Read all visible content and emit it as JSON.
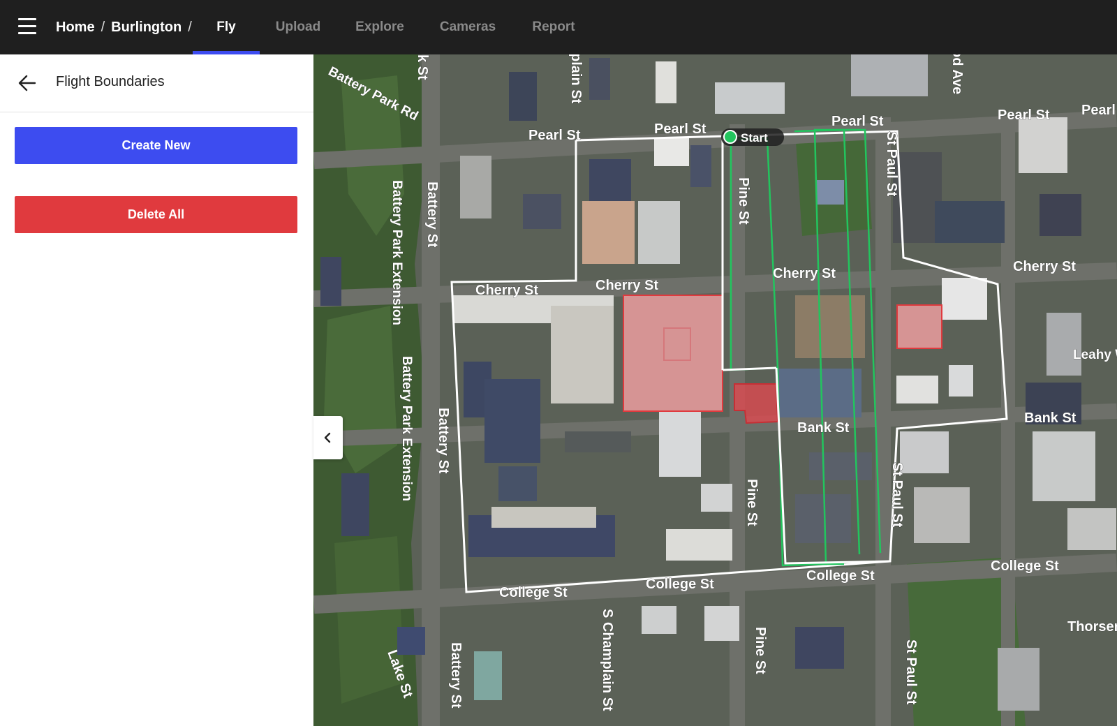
{
  "header": {
    "breadcrumb": [
      "Home",
      "Burlington"
    ],
    "separator": "/",
    "tabs": [
      {
        "label": "Fly",
        "active": true
      },
      {
        "label": "Upload",
        "active": false
      },
      {
        "label": "Explore",
        "active": false
      },
      {
        "label": "Cameras",
        "active": false
      },
      {
        "label": "Report",
        "active": false
      }
    ],
    "accent_color": "#3d4cf0"
  },
  "sidebar": {
    "title": "Flight Boundaries",
    "create_label": "Create New",
    "delete_label": "Delete All",
    "create_color": "#3d4cf0",
    "delete_color": "#e03a3e"
  },
  "map": {
    "start_label": "Start",
    "streets": [
      "Battery Park Rd",
      "Pearl St",
      "Pearl St",
      "Pearl St",
      "Pearl St",
      "Pearl",
      "Cherry St",
      "Cherry St",
      "Cherry St",
      "Cherry St",
      "Battery St",
      "Battery St",
      "Battery St",
      "Battery Park Extension",
      "Battery Park Extension",
      "Pine St",
      "Pine St",
      "Pine St",
      "St Paul St",
      "St Paul St",
      "St Paul St",
      "Bank St",
      "Bank St",
      "Leahy Wy",
      "College St",
      "College St",
      "College St",
      "College St",
      "S Champlain St",
      "Lake St",
      "Thorsen",
      "od Ave",
      "plain St",
      "k St"
    ],
    "boundary_color": "#ffffff",
    "flight_path_color": "#22c55e",
    "no_fly_color": "#e03a3e"
  }
}
